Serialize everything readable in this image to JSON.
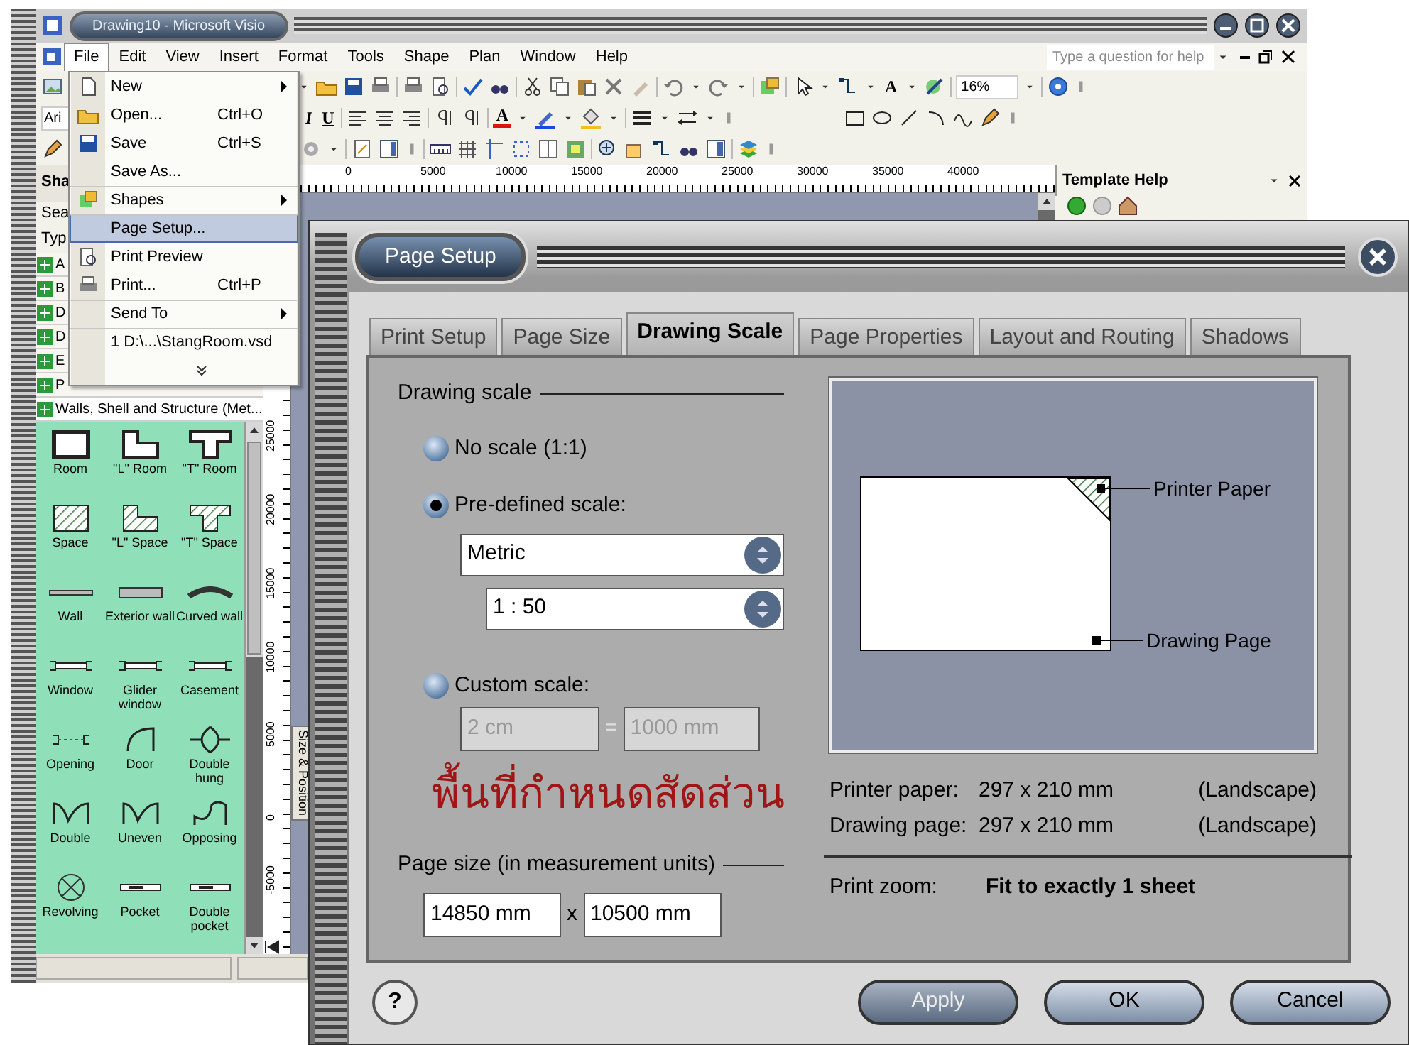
{
  "app": {
    "title": "Drawing10 - Microsoft Visio",
    "menus": [
      {
        "label": "File",
        "selected": true
      },
      {
        "label": "Edit",
        "selected": false
      },
      {
        "label": "View",
        "selected": false
      },
      {
        "label": "Insert",
        "selected": false
      },
      {
        "label": "Format",
        "selected": false
      },
      {
        "label": "Tools",
        "selected": false
      },
      {
        "label": "Shape",
        "selected": false
      },
      {
        "label": "Plan",
        "selected": false
      },
      {
        "label": "Window",
        "selected": false
      },
      {
        "label": "Help",
        "selected": false
      }
    ],
    "help_placeholder": "Type a question for help",
    "font_field": "Ari",
    "format_buttons": [
      "I",
      "U"
    ],
    "font_color_glyph": "A",
    "text_tool_glyph": "A",
    "zoom": "16%",
    "ruler_labels": [
      "0",
      "5000",
      "10000",
      "15000",
      "20000",
      "25000",
      "30000",
      "35000",
      "40000"
    ],
    "vertical_ruler_labels": [
      "25000",
      "20000",
      "15000",
      "10000",
      "5000",
      "0",
      "-5000"
    ],
    "shapes_pane": {
      "title": "Sha",
      "search_label": "Sea",
      "type_label": "Typ",
      "stencils": [
        {
          "label": "A",
          "open": false
        },
        {
          "label": "B",
          "open": false
        },
        {
          "label": "D",
          "open": false
        },
        {
          "label": "D",
          "open": false
        },
        {
          "label": "E",
          "open": false
        },
        {
          "label": "P",
          "open": false
        },
        {
          "label": "Walls, Shell and Structure (Met...",
          "open": true
        }
      ],
      "shapes": [
        {
          "label": "Room",
          "kind": "room"
        },
        {
          "label": "\"L\" Room",
          "kind": "l-room"
        },
        {
          "label": "\"T\" Room",
          "kind": "t-room"
        },
        {
          "label": "Space",
          "kind": "space"
        },
        {
          "label": "\"L\" Space",
          "kind": "l-space"
        },
        {
          "label": "\"T\" Space",
          "kind": "t-space"
        },
        {
          "label": "Wall",
          "kind": "wall"
        },
        {
          "label": "Exterior wall",
          "kind": "exterior-wall"
        },
        {
          "label": "Curved wall",
          "kind": "curved-wall"
        },
        {
          "label": "Window",
          "kind": "window"
        },
        {
          "label": "Glider window",
          "kind": "window"
        },
        {
          "label": "Casement",
          "kind": "window"
        },
        {
          "label": "Opening",
          "kind": "opening"
        },
        {
          "label": "Door",
          "kind": "door"
        },
        {
          "label": "Double hung",
          "kind": "double-hung"
        },
        {
          "label": "Double",
          "kind": "double-door"
        },
        {
          "label": "Uneven",
          "kind": "double-door"
        },
        {
          "label": "Opposing",
          "kind": "opposing"
        },
        {
          "label": "Revolving",
          "kind": "revolving"
        },
        {
          "label": "Pocket",
          "kind": "pocket"
        },
        {
          "label": "Double pocket",
          "kind": "pocket"
        }
      ]
    },
    "template_help": "Template Help",
    "side_tab": "Size & Position"
  },
  "file_menu": [
    {
      "label": "New",
      "submenu": true,
      "divider_above": false,
      "selected": false
    },
    {
      "label": "Open...",
      "shortcut": "Ctrl+O",
      "submenu": false,
      "divider_above": false,
      "selected": false
    },
    {
      "label": "Save",
      "shortcut": "Ctrl+S",
      "submenu": false,
      "divider_above": false,
      "selected": false
    },
    {
      "label": "Save As...",
      "submenu": false,
      "divider_above": false,
      "selected": false
    },
    {
      "label": "Shapes",
      "submenu": true,
      "divider_above": true,
      "selected": false
    },
    {
      "label": "Page Setup...",
      "submenu": false,
      "divider_above": true,
      "selected": true
    },
    {
      "label": "Print Preview",
      "submenu": false,
      "divider_above": false,
      "selected": false
    },
    {
      "label": "Print...",
      "shortcut": "Ctrl+P",
      "submenu": false,
      "divider_above": false,
      "selected": false
    },
    {
      "label": "Send To",
      "submenu": true,
      "divider_above": true,
      "selected": false
    },
    {
      "label": "1 D:\\...\\StangRoom.vsd",
      "submenu": false,
      "divider_above": true,
      "selected": false
    }
  ],
  "dialog": {
    "title": "Page Setup",
    "tabs": [
      {
        "label": "Print Setup",
        "selected": false
      },
      {
        "label": "Page Size",
        "selected": false
      },
      {
        "label": "Drawing Scale",
        "selected": true
      },
      {
        "label": "Page Properties",
        "selected": false
      },
      {
        "label": "Layout and Routing",
        "selected": false
      },
      {
        "label": "Shadows",
        "selected": false
      }
    ],
    "scale_group": {
      "legend": "Drawing scale",
      "options": [
        {
          "label": "No scale (1:1)",
          "selected": false
        },
        {
          "label": "Pre-defined scale:",
          "selected": true
        },
        {
          "label": "Custom scale:",
          "selected": false
        }
      ],
      "scale_type": "Metric",
      "scale_value": "1 : 50",
      "custom_left": "2 cm",
      "equals": "=",
      "custom_right": "1000 mm",
      "custom_disabled": true
    },
    "annotation": "พื้นที่กำหนดสัดส่วน",
    "page_size": {
      "legend": "Page size (in measurement units)",
      "width": "14850 mm",
      "times": "x",
      "height": "10500 mm"
    },
    "preview": {
      "printer_label": "Printer Paper",
      "drawing_label": "Drawing Page"
    },
    "info": [
      {
        "label": "Printer paper:",
        "value": "297 x 210 mm",
        "orientation": "(Landscape)"
      },
      {
        "label": "Drawing page:",
        "value": "297 x 210 mm",
        "orientation": "(Landscape)"
      }
    ],
    "zoom": {
      "label": "Print zoom:",
      "value": "Fit to exactly 1 sheet"
    },
    "help_button": "?",
    "buttons": [
      {
        "label": "Apply",
        "disabled": true
      },
      {
        "label": "OK",
        "disabled": false
      },
      {
        "label": "Cancel",
        "disabled": false
      }
    ]
  }
}
